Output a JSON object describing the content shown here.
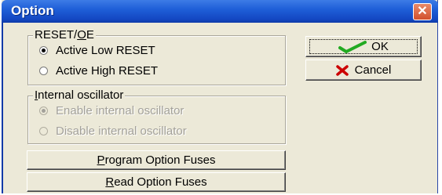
{
  "window": {
    "title": "Option",
    "close": "✕"
  },
  "reset_group": {
    "legend_pre": "RESET/",
    "legend_ul": "O",
    "legend_post": "E",
    "options": [
      "Active Low RESET",
      "Active High RESET"
    ],
    "selected": "Active Low RESET"
  },
  "osc_group": {
    "legend_ul": "I",
    "legend_post": "nternal oscillator",
    "options": [
      "Enable internal oscillator",
      "Disable internal oscillator"
    ],
    "selected": "Enable internal oscillator",
    "enabled": false
  },
  "buttons": {
    "ok": "OK",
    "cancel": "Cancel",
    "program_ul": "P",
    "program_rest": "rogram Option Fuses",
    "read_ul": "R",
    "read_rest": "ead Option Fuses"
  },
  "colors": {
    "titlebar": "#1f5fd8",
    "ok_check": "#22aa22",
    "cancel_x": "#cc0000",
    "face": "#ece9d8"
  }
}
